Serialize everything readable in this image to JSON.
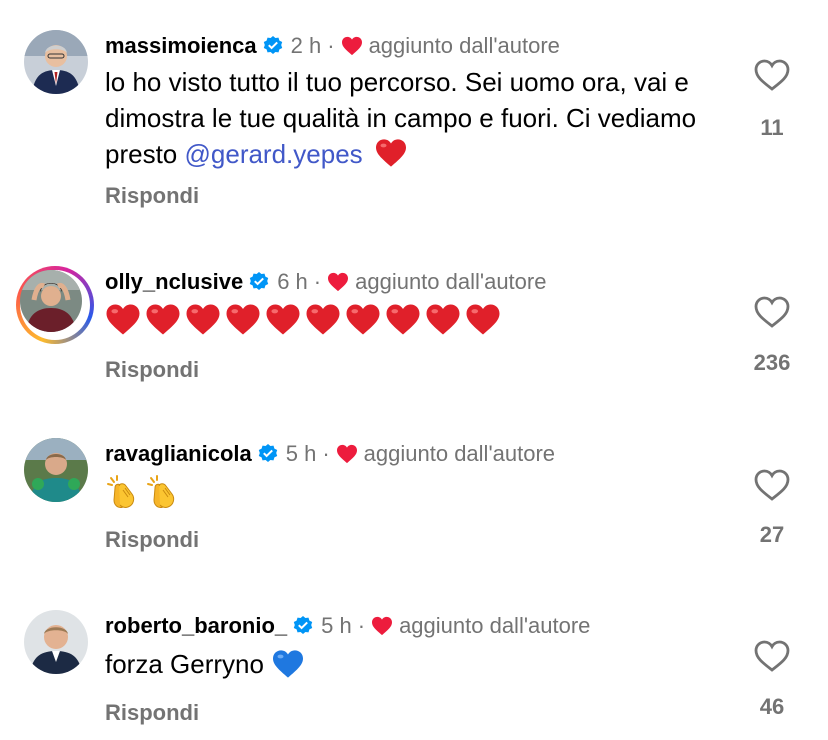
{
  "comments": [
    {
      "username": "massimoienca",
      "time": "2 h",
      "separator": "·",
      "author_badge": "aggiunto dall'autore",
      "text": "lo ho visto tutto il tuo percorso. Sei uomo ora, vai e dimostra le tue qualità in campo e fuori. Ci vediamo presto ",
      "mention": "@gerard.yepes",
      "emoji": "red-heart",
      "reply_label": "Rispondi",
      "likes": "11",
      "avatar_icon": "person-suit-avatar"
    },
    {
      "username": "olly_nclusive",
      "time": "6 h",
      "separator": "·",
      "author_badge": "aggiunto dall'autore",
      "emoji_count": 10,
      "emoji": "red-heart",
      "reply_label": "Rispondi",
      "likes": "236",
      "avatar_icon": "person-story-avatar"
    },
    {
      "username": "ravaglianicola",
      "time": "5 h",
      "separator": "·",
      "author_badge": "aggiunto dall'autore",
      "emoji_count": 2,
      "emoji": "clapping-hands",
      "reply_label": "Rispondi",
      "likes": "27",
      "avatar_icon": "person-goalkeeper-avatar"
    },
    {
      "username": "roberto_baronio_",
      "time": "5 h",
      "separator": "·",
      "author_badge": "aggiunto dall'autore",
      "text": "forza Gerryno ",
      "emoji": "blue-heart",
      "reply_label": "Rispondi",
      "likes": "46",
      "avatar_icon": "person-portrait-avatar"
    }
  ],
  "colors": {
    "verified": "#0095f6",
    "author_heart": "#ed1c3d",
    "secondary_text": "#737373",
    "mention": "#4158c8"
  }
}
